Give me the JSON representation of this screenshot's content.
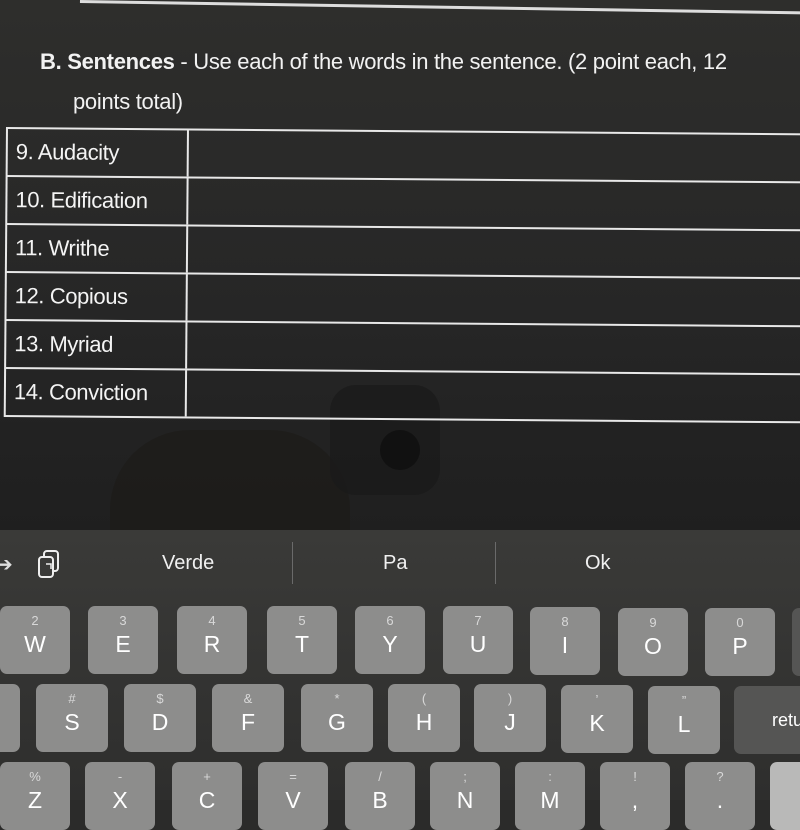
{
  "document": {
    "section_letter": "B.",
    "section_title": "Sentences",
    "instructions_line1": " - Use each of the words in the sentence. (2 point each, 12",
    "instructions_line2": "points total)",
    "rows": [
      {
        "word": "9. Audacity",
        "answer": ""
      },
      {
        "word": "10. Edification",
        "answer": ""
      },
      {
        "word": "11. Writhe",
        "answer": ""
      },
      {
        "word": "12. Copious",
        "answer": ""
      },
      {
        "word": "13. Myriad",
        "answer": ""
      },
      {
        "word": "14. Conviction",
        "answer": ""
      }
    ]
  },
  "keyboard": {
    "suggestions": [
      "Verde",
      "Pa",
      "Ok"
    ],
    "icons": {
      "forward": "arrow-right-icon",
      "paste": "paste-icon"
    },
    "row1": [
      {
        "alt": "2",
        "main": "W"
      },
      {
        "alt": "3",
        "main": "E"
      },
      {
        "alt": "4",
        "main": "R"
      },
      {
        "alt": "5",
        "main": "T"
      },
      {
        "alt": "6",
        "main": "Y"
      },
      {
        "alt": "7",
        "main": "U"
      },
      {
        "alt": "8",
        "main": "I"
      },
      {
        "alt": "9",
        "main": "O"
      },
      {
        "alt": "0",
        "main": "P"
      }
    ],
    "row2": [
      {
        "alt": "#",
        "main": "S"
      },
      {
        "alt": "$",
        "main": "D"
      },
      {
        "alt": "&",
        "main": "F"
      },
      {
        "alt": "*",
        "main": "G"
      },
      {
        "alt": "(",
        "main": "H"
      },
      {
        "alt": ")",
        "main": "J"
      },
      {
        "alt": "’",
        "main": "K"
      },
      {
        "alt": "”",
        "main": "L"
      }
    ],
    "return_label": "return",
    "row3": [
      {
        "alt": "%",
        "main": "Z"
      },
      {
        "alt": "-",
        "main": "X"
      },
      {
        "alt": "+",
        "main": "C"
      },
      {
        "alt": "=",
        "main": "V"
      },
      {
        "alt": "/",
        "main": "B"
      },
      {
        "alt": ";",
        "main": "N"
      },
      {
        "alt": ":",
        "main": "M"
      },
      {
        "alt": "!",
        "main": ","
      },
      {
        "alt": "?",
        "main": "."
      }
    ]
  }
}
